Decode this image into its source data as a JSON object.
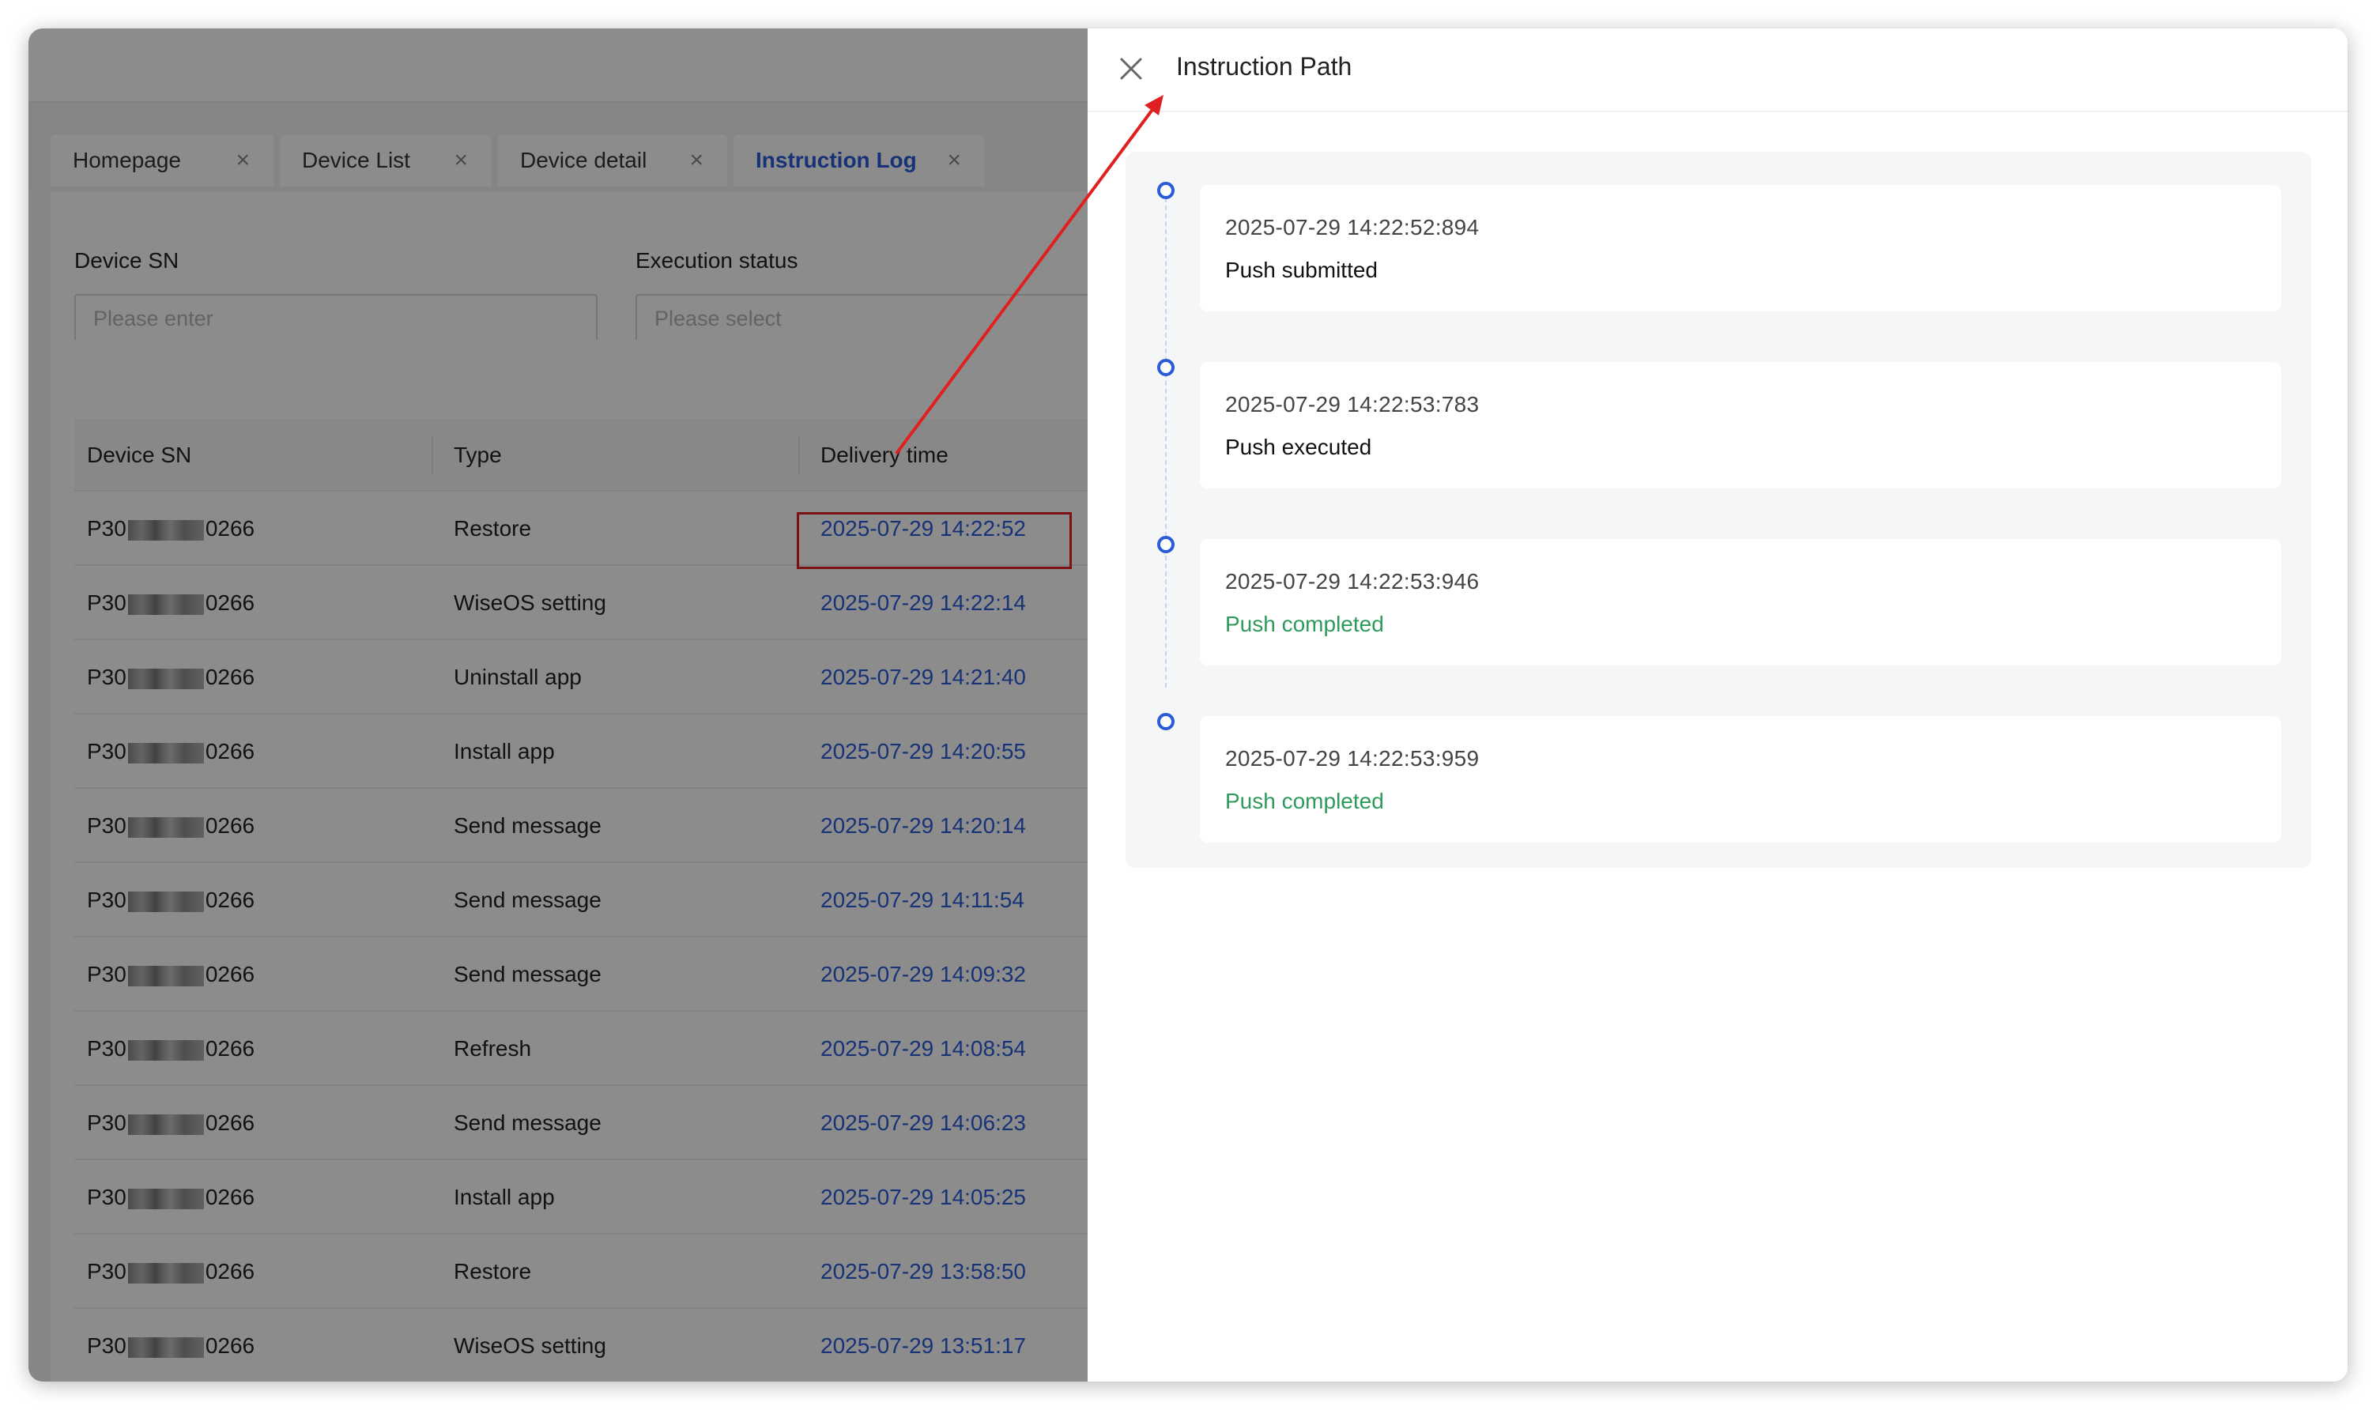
{
  "tabs": [
    {
      "label": "Homepage",
      "close": "×"
    },
    {
      "label": "Device List",
      "close": "×"
    },
    {
      "label": "Device detail",
      "close": "×"
    },
    {
      "label": "Instruction Log",
      "close": "×"
    }
  ],
  "filters": {
    "device_sn_label": "Device SN",
    "device_sn_placeholder": "Please enter",
    "status_label": "Execution status",
    "status_placeholder": "Please select"
  },
  "table": {
    "headers": [
      "Device SN",
      "Type",
      "Delivery time"
    ],
    "rows": [
      {
        "sn_prefix": "P30",
        "sn_suffix": "0266",
        "type": "Restore",
        "time": "2025-07-29 14:22:52"
      },
      {
        "sn_prefix": "P30",
        "sn_suffix": "0266",
        "type": "WiseOS setting",
        "time": "2025-07-29 14:22:14"
      },
      {
        "sn_prefix": "P30",
        "sn_suffix": "0266",
        "type": "Uninstall app",
        "time": "2025-07-29 14:21:40"
      },
      {
        "sn_prefix": "P30",
        "sn_suffix": "0266",
        "type": "Install app",
        "time": "2025-07-29 14:20:55"
      },
      {
        "sn_prefix": "P30",
        "sn_suffix": "0266",
        "type": "Send message",
        "time": "2025-07-29 14:20:14"
      },
      {
        "sn_prefix": "P30",
        "sn_suffix": "0266",
        "type": "Send message",
        "time": "2025-07-29 14:11:54"
      },
      {
        "sn_prefix": "P30",
        "sn_suffix": "0266",
        "type": "Send message",
        "time": "2025-07-29 14:09:32"
      },
      {
        "sn_prefix": "P30",
        "sn_suffix": "0266",
        "type": "Refresh",
        "time": "2025-07-29 14:08:54"
      },
      {
        "sn_prefix": "P30",
        "sn_suffix": "0266",
        "type": "Send message",
        "time": "2025-07-29 14:06:23"
      },
      {
        "sn_prefix": "P30",
        "sn_suffix": "0266",
        "type": "Install app",
        "time": "2025-07-29 14:05:25"
      },
      {
        "sn_prefix": "P30",
        "sn_suffix": "0266",
        "type": "Restore",
        "time": "2025-07-29 13:58:50"
      },
      {
        "sn_prefix": "P30",
        "sn_suffix": "0266",
        "type": "WiseOS setting",
        "time": "2025-07-29 13:51:17"
      }
    ]
  },
  "drawer": {
    "title": "Instruction Path",
    "close_icon": "close-icon",
    "events": [
      {
        "time": "2025-07-29 14:22:52:894",
        "status": "Push submitted"
      },
      {
        "time": "2025-07-29 14:22:53:783",
        "status": "Push executed"
      },
      {
        "time": "2025-07-29 14:22:53:946",
        "status": "Push completed"
      },
      {
        "time": "2025-07-29 14:22:53:959",
        "status": "Push completed"
      }
    ]
  },
  "colors": {
    "link": "#2a5bd7",
    "completed": "#2e9a5c",
    "annotation": "#e02020"
  }
}
